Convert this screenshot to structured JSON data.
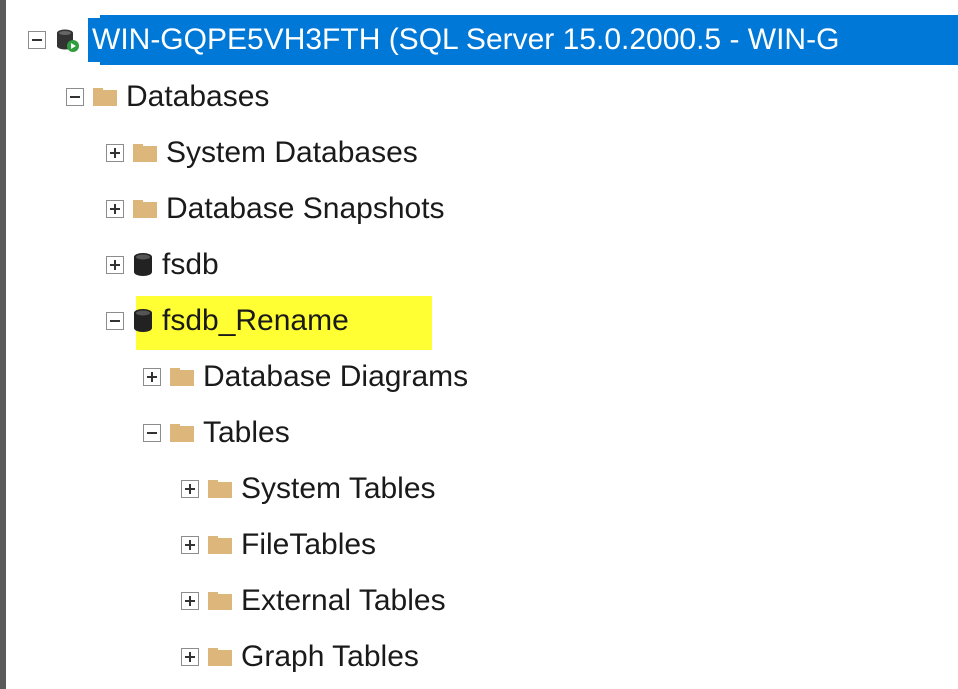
{
  "tree": {
    "server": {
      "label": "WIN-GQPE5VH3FTH (SQL Server 15.0.2000.5 - WIN-G",
      "expanded": true,
      "icon": "server-connected-icon",
      "selected_color": "#0078d7"
    },
    "databases": {
      "label": "Databases",
      "expanded": true,
      "icon": "folder-icon"
    },
    "items": [
      {
        "label": "System Databases",
        "expanded": false,
        "icon": "folder-icon"
      },
      {
        "label": "Database Snapshots",
        "expanded": false,
        "icon": "folder-icon"
      },
      {
        "label": "fsdb",
        "expanded": false,
        "icon": "database-icon"
      },
      {
        "label": "fsdb_Rename",
        "expanded": true,
        "icon": "database-icon",
        "highlight_color": "#ffff33"
      }
    ],
    "fsdb_rename_children": [
      {
        "label": "Database Diagrams",
        "expanded": false,
        "icon": "folder-icon"
      },
      {
        "label": "Tables",
        "expanded": true,
        "icon": "folder-icon"
      }
    ],
    "tables_children": [
      {
        "label": "System Tables",
        "expanded": false,
        "icon": "folder-icon"
      },
      {
        "label": "FileTables",
        "expanded": false,
        "icon": "folder-icon"
      },
      {
        "label": "External Tables",
        "expanded": false,
        "icon": "folder-icon"
      },
      {
        "label": "Graph Tables",
        "expanded": false,
        "icon": "folder-icon"
      }
    ]
  }
}
